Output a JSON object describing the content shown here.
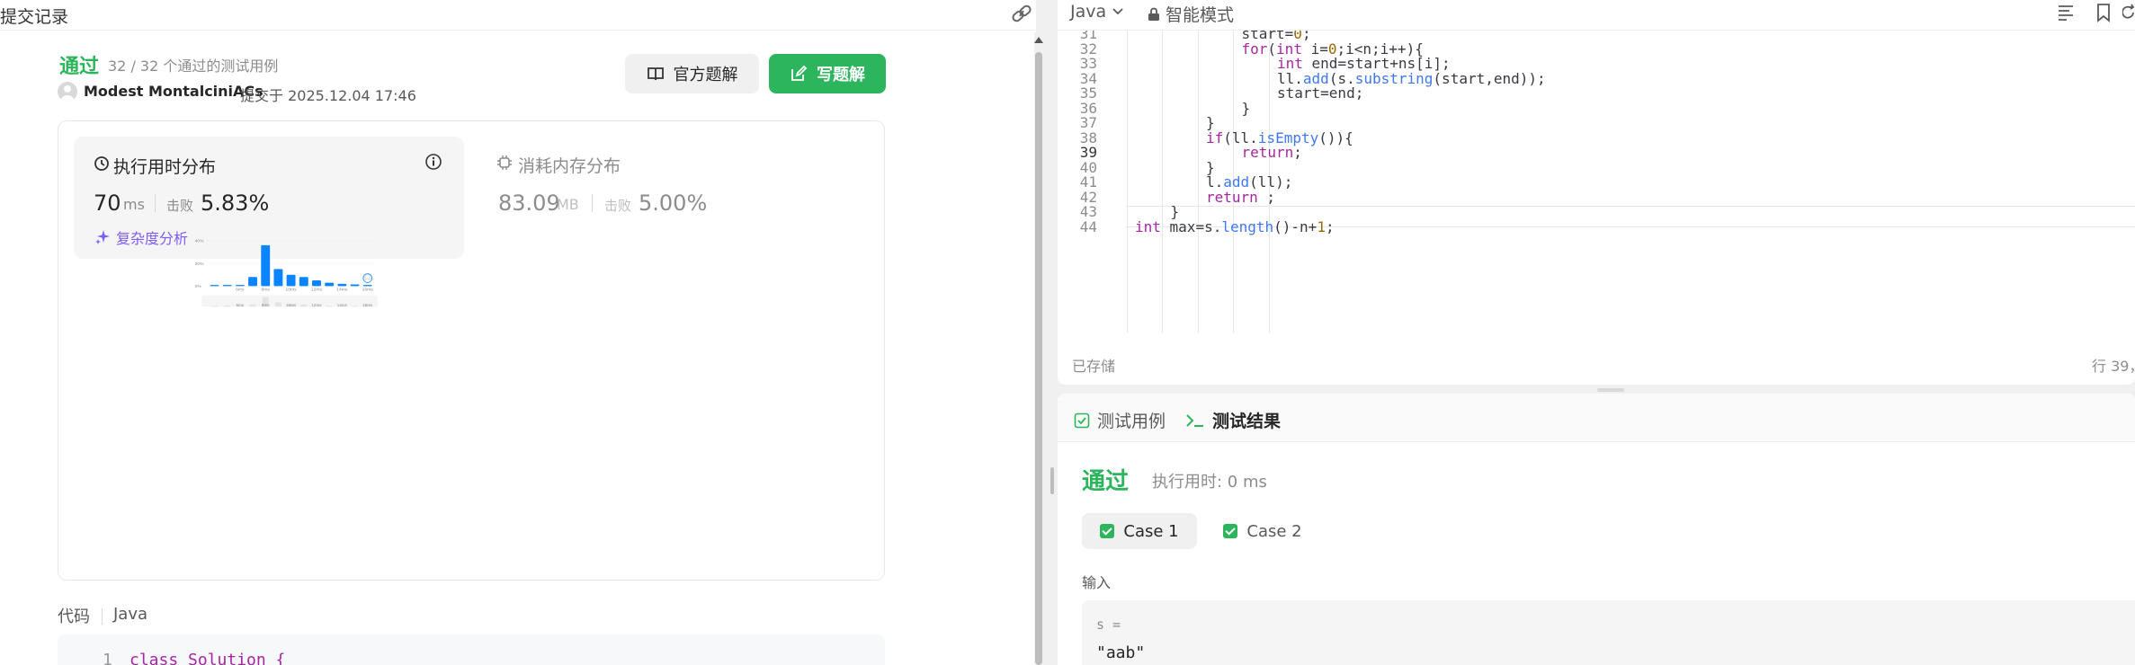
{
  "left_panel": {
    "title": "提交记录",
    "submission": {
      "status": "通过",
      "count_text": "32 / 32 个通过的测试用例",
      "user": "Modest MontalciniACs",
      "submitted_at": "提交于 2025.12.04 17:46"
    },
    "buttons": {
      "official_solution": "官方题解",
      "write_solution": "写题解"
    },
    "runtime": {
      "title": "执行用时分布",
      "value": "70",
      "unit": "ms",
      "beats_label": "击败",
      "beats": "5.83%",
      "complexity_link": "复杂度分析"
    },
    "memory": {
      "title": "消耗内存分布",
      "value": "83.09",
      "unit": "MB",
      "beats_label": "击败",
      "beats": "5.00%"
    },
    "code_section": {
      "label": "代码",
      "language": "Java",
      "first_line_number": "1",
      "first_line": "class Solution {"
    }
  },
  "chart_data": {
    "type": "bar",
    "title": "",
    "xlabel": "",
    "ylabel": "",
    "categories": [
      "",
      "",
      "6ms",
      "",
      "8ms",
      "",
      "10ms",
      "",
      "12ms",
      "",
      "14ms",
      "",
      "16ms"
    ],
    "values": [
      1,
      1,
      1,
      8,
      36,
      15,
      10,
      8,
      5,
      3,
      2,
      1.5,
      1
    ],
    "ylim": [
      0,
      40
    ],
    "yticks": [
      "0%",
      "20%",
      "40%"
    ],
    "xticks": [
      "6ms",
      "8ms",
      "10ms",
      "12ms",
      "14ms",
      "16ms"
    ],
    "grid": true,
    "current_submission_bucket": "16ms",
    "bar_color": "#0a84ff",
    "overview_values": [
      1,
      1,
      1,
      2,
      9,
      4,
      2,
      2,
      1,
      1,
      1,
      1,
      1
    ]
  },
  "editor": {
    "language": "Java",
    "mode": "智能模式",
    "lines": [
      {
        "n": "31",
        "indent": 5,
        "code": [
          [
            "plain",
            "start="
          ],
          [
            "num",
            "0"
          ],
          [
            "plain",
            ";"
          ]
        ]
      },
      {
        "n": "32",
        "indent": 5,
        "code": [
          [
            "kw",
            "for"
          ],
          [
            "plain",
            "("
          ],
          [
            "kw",
            "int"
          ],
          [
            "plain",
            " i="
          ],
          [
            "num",
            "0"
          ],
          [
            "plain",
            ";i<n;i++){"
          ]
        ]
      },
      {
        "n": "33",
        "indent": 6,
        "code": [
          [
            "kw",
            "int"
          ],
          [
            "plain",
            " end=start+ns[i];"
          ]
        ]
      },
      {
        "n": "34",
        "indent": 6,
        "code": [
          [
            "plain",
            "ll."
          ],
          [
            "fn",
            "add"
          ],
          [
            "plain",
            "(s."
          ],
          [
            "fn",
            "substring"
          ],
          [
            "plain",
            "(start,end));"
          ]
        ]
      },
      {
        "n": "35",
        "indent": 6,
        "code": [
          [
            "plain",
            "start=end;"
          ]
        ]
      },
      {
        "n": "36",
        "indent": 5,
        "code": [
          [
            "plain",
            "}"
          ]
        ]
      },
      {
        "n": "37",
        "indent": 4,
        "code": [
          [
            "plain",
            "}"
          ]
        ]
      },
      {
        "n": "38",
        "indent": 4,
        "code": [
          [
            "kw",
            "if"
          ],
          [
            "plain",
            "(ll."
          ],
          [
            "fn",
            "isEmpty"
          ],
          [
            "plain",
            "()){"
          ]
        ]
      },
      {
        "n": "39",
        "indent": 5,
        "code": [
          [
            "kw",
            "return"
          ],
          [
            "plain",
            ";"
          ]
        ],
        "active": true
      },
      {
        "n": "40",
        "indent": 4,
        "code": [
          [
            "plain",
            "}"
          ]
        ]
      },
      {
        "n": "41",
        "indent": 4,
        "code": [
          [
            "plain",
            "l."
          ],
          [
            "fn",
            "add"
          ],
          [
            "plain",
            "(ll);"
          ]
        ]
      },
      {
        "n": "42",
        "indent": 4,
        "code": [
          [
            "kw",
            "return"
          ],
          [
            "plain",
            " ;"
          ]
        ]
      },
      {
        "n": "43",
        "indent": 3,
        "code": [
          [
            "plain",
            "}"
          ]
        ]
      },
      {
        "n": "44",
        "indent": 2,
        "code": [
          [
            "kw",
            "int"
          ],
          [
            "plain",
            " max=s."
          ],
          [
            "fn",
            "length"
          ],
          [
            "plain",
            "()-n+"
          ],
          [
            "num",
            "1"
          ],
          [
            "plain",
            ";"
          ]
        ]
      }
    ],
    "status_left": "已存储",
    "status_right": "行 39，"
  },
  "test_panel": {
    "tab_testcase": "测试用例",
    "tab_result": "测试结果",
    "result_status": "通过",
    "result_time": "执行用时: 0 ms",
    "cases": [
      "Case 1",
      "Case 2"
    ],
    "input_label": "输入",
    "input_var": "s =",
    "input_value": "\"aab\""
  },
  "colors": {
    "accent_green": "#2db55d",
    "bar_blue": "#0a84ff",
    "purple_link": "#7c5cfc"
  },
  "icons": [
    "link-icon",
    "clock-icon",
    "info-icon",
    "memory-icon",
    "sparkle-icon",
    "book-icon",
    "edit-icon",
    "lock-icon",
    "chevron-down-icon",
    "list-icon",
    "bookmark-icon",
    "refresh-icon",
    "check-square-icon",
    "terminal-icon"
  ]
}
